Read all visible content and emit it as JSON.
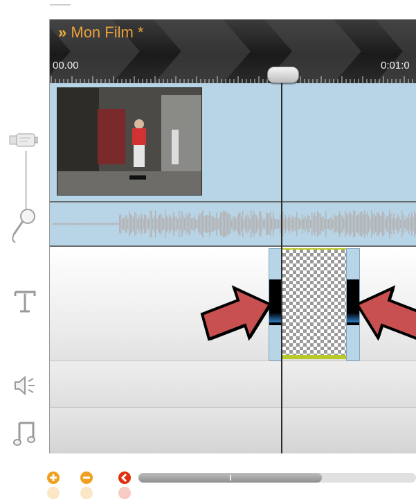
{
  "project": {
    "title": "Mon Film *",
    "title_marker": "»"
  },
  "ruler": {
    "start_label": "00.00",
    "end_label": "0:01:0"
  },
  "tracks": [
    {
      "name": "video",
      "icon": "video-camera-icon"
    },
    {
      "name": "audio",
      "icon": "microphone-icon"
    },
    {
      "name": "titles",
      "icon": "text-t-icon"
    },
    {
      "name": "sound-effects",
      "icon": "speaker-icon"
    },
    {
      "name": "music",
      "icon": "music-note-icon"
    }
  ],
  "zoom": {
    "in_icon": "plus-icon",
    "out_icon": "minus-icon",
    "reset_icon": "record-icon",
    "scroll_position": 0.6
  },
  "colors": {
    "header_bg": "#1a1a1a",
    "title_color": "#e9a13a",
    "track_blue": "#b8d5e8",
    "clip_border": "#b9c92a",
    "arrow_red": "#c85050",
    "zoom_orange": "#f0a020",
    "zoom_red": "#e03010"
  }
}
